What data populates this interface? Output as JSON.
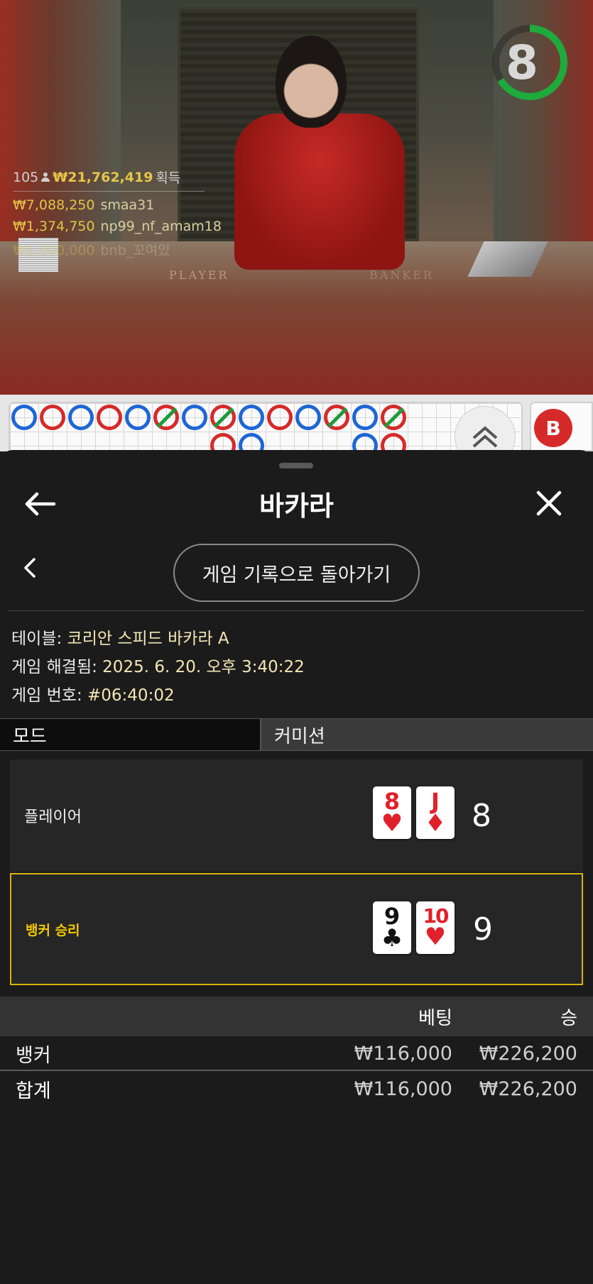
{
  "video": {
    "timer": "8",
    "felt_labels": [
      "PLAYER",
      "BANKER"
    ],
    "winners": {
      "count": "105",
      "total": "₩21,762,419",
      "suffix": "획득",
      "rows": [
        {
          "amount": "₩7,088,250",
          "name": "smaa31"
        },
        {
          "amount": "₩1,374,750",
          "name": "np99_nf_amam18"
        },
        {
          "amount": "₩1,000,000",
          "name": "bnb_꼬여있"
        }
      ]
    }
  },
  "road": {
    "badge": "B"
  },
  "sheet": {
    "title": "바카라",
    "history_button": "게임 기록으로 돌아가기",
    "info": [
      {
        "label": "테이블: ",
        "value": "코리안 스피드 바카라 A"
      },
      {
        "label": "게임 해결됨: ",
        "value": "2025. 6. 20. 오후 3:40:22"
      },
      {
        "label": "게임 번호: ",
        "value": "#06:40:02"
      }
    ],
    "mode": {
      "label": "모드",
      "value": "커미션"
    },
    "player": {
      "label": "플레이어",
      "cards": [
        {
          "rank": "8",
          "suit": "♥"
        },
        {
          "rank": "J",
          "suit": "♦"
        }
      ],
      "score": "8"
    },
    "banker": {
      "label": "뱅커 승리",
      "cards": [
        {
          "rank": "9",
          "suit": "♣"
        },
        {
          "rank": "10",
          "suit": "♥"
        }
      ],
      "score": "9"
    },
    "bets_table": {
      "headers": {
        "bet": "베팅",
        "win": "승"
      },
      "rows": [
        {
          "label": "뱅커",
          "bet": "₩116,000",
          "win": "₩226,200"
        },
        {
          "label": "합계",
          "bet": "₩116,000",
          "win": "₩226,200"
        }
      ]
    }
  },
  "colors": {
    "timer_ring": "#1faa3c",
    "winner_amount": "#e2c447",
    "banker_win_border": "#d8b20c",
    "red_suit": "#e0212a"
  },
  "icons": [
    "back-arrow-icon",
    "close-icon",
    "chevron-left-icon",
    "chevrons-up-icon",
    "user-icon"
  ]
}
